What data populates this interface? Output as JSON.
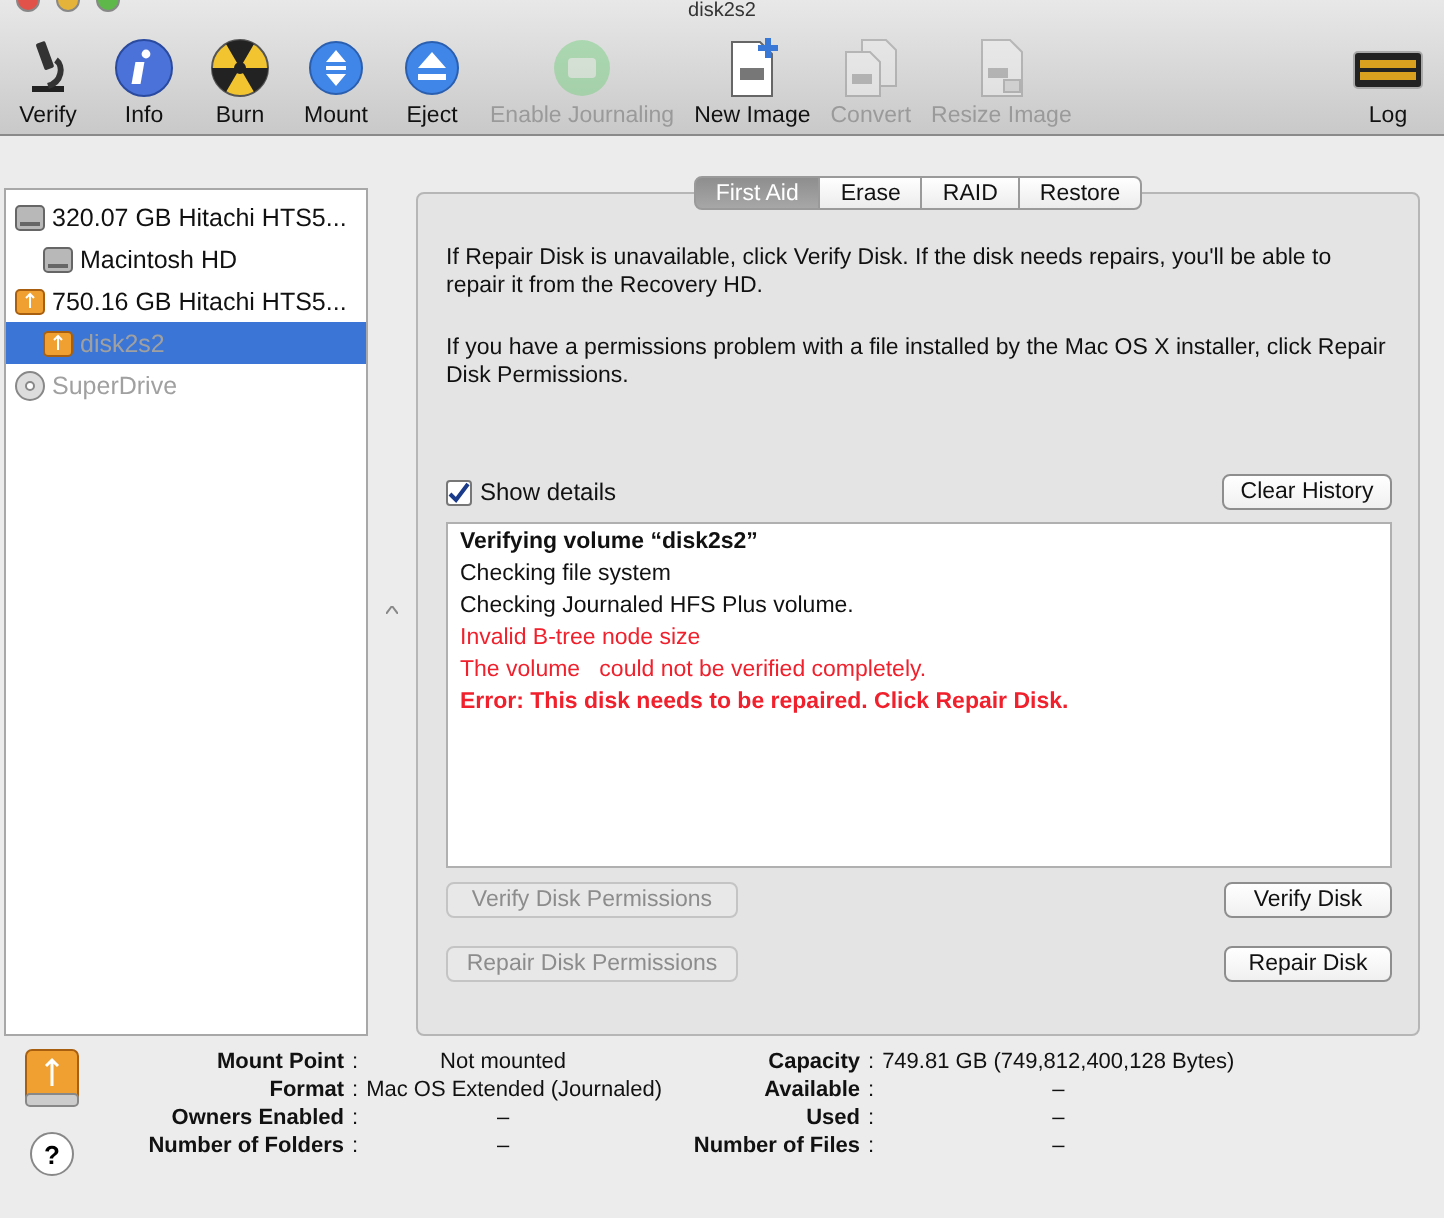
{
  "window": {
    "title": "disk2s2"
  },
  "toolbar": {
    "items": [
      {
        "label": "Verify",
        "kind": "microscope",
        "disabled": false
      },
      {
        "label": "Info",
        "kind": "info",
        "disabled": false
      },
      {
        "label": "Burn",
        "kind": "burn",
        "disabled": false
      },
      {
        "label": "Mount",
        "kind": "mount",
        "disabled": false
      },
      {
        "label": "Eject",
        "kind": "eject",
        "disabled": false
      },
      {
        "label": "Enable Journaling",
        "kind": "journal",
        "disabled": true
      },
      {
        "label": "New Image",
        "kind": "newimage",
        "disabled": false
      },
      {
        "label": "Convert",
        "kind": "convert",
        "disabled": true
      },
      {
        "label": "Resize Image",
        "kind": "resize",
        "disabled": true
      }
    ],
    "log": {
      "label": "Log"
    }
  },
  "sidebar": {
    "items": [
      {
        "label": "320.07 GB Hitachi HTS5...",
        "kind": "hdd",
        "selected": false,
        "dimmed": false,
        "children": [
          {
            "label": "Macintosh HD",
            "kind": "hdd",
            "selected": false,
            "dimmed": false
          }
        ]
      },
      {
        "label": "750.16 GB Hitachi HTS5...",
        "kind": "usb",
        "selected": false,
        "dimmed": false,
        "children": [
          {
            "label": "disk2s2",
            "kind": "usb",
            "selected": true,
            "dimmed": true
          }
        ]
      },
      {
        "label": "SuperDrive",
        "kind": "disc",
        "selected": false,
        "dimmed": true
      }
    ]
  },
  "tabs": [
    {
      "label": "First Aid",
      "selected": true
    },
    {
      "label": "Erase",
      "selected": false
    },
    {
      "label": "RAID",
      "selected": false
    },
    {
      "label": "Restore",
      "selected": false
    }
  ],
  "first_aid": {
    "paragraphs": [
      "If Repair Disk is unavailable, click Verify Disk. If the disk needs repairs, you'll be able to repair it from the Recovery HD.",
      "If you have a permissions problem with a file installed by the Mac OS X installer, click Repair Disk Permissions."
    ],
    "show_details": {
      "label": "Show details",
      "checked": true
    },
    "clear_history": "Clear History",
    "log": [
      {
        "text": "Verifying volume “disk2s2”",
        "kind": "heading"
      },
      {
        "text": "Checking file system",
        "kind": "normal"
      },
      {
        "text": "Checking Journaled HFS Plus volume.",
        "kind": "normal"
      },
      {
        "text": "Invalid B-tree node size",
        "kind": "warning"
      },
      {
        "text": "The volume   could not be verified completely.",
        "kind": "warning"
      },
      {
        "text": "Error: This disk needs to be repaired. Click Repair Disk.",
        "kind": "error"
      }
    ],
    "buttons": [
      {
        "label": "Verify Disk Permissions",
        "disabled": true
      },
      {
        "label": "Verify Disk",
        "disabled": false
      },
      {
        "label": "Repair Disk Permissions",
        "disabled": true
      },
      {
        "label": "Repair Disk",
        "disabled": false
      }
    ]
  },
  "info": {
    "help": "?",
    "left": [
      {
        "label": "Mount Point",
        "value": "Not mounted"
      },
      {
        "label": "Format",
        "value": "Mac OS Extended (Journaled)"
      },
      {
        "label": "Owners Enabled",
        "value": "–"
      },
      {
        "label": "Number of Folders",
        "value": "–"
      }
    ],
    "right": [
      {
        "label": "Capacity",
        "value": "749.81 GB (749,812,400,128 Bytes)"
      },
      {
        "label": "Available",
        "value": "–"
      },
      {
        "label": "Used",
        "value": "–"
      },
      {
        "label": "Number of Files",
        "value": "–"
      }
    ],
    "separator": ":"
  }
}
